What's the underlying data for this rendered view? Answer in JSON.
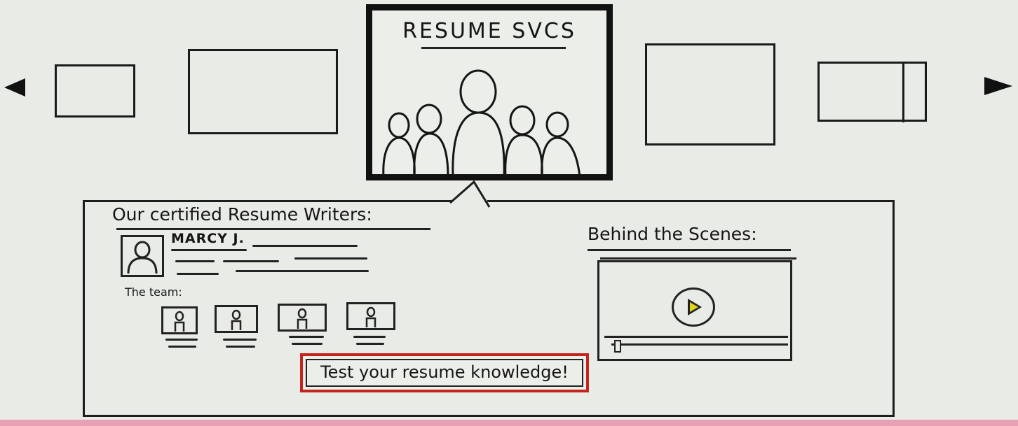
{
  "carousel": {
    "featured_title": "RESUME SVCS",
    "prev_icon": "triangle-left-icon",
    "next_icon": "triangle-right-icon"
  },
  "writers": {
    "title": "Our certified Resume Writers:",
    "profile_name": "MARCY J.",
    "team_label": "The team:"
  },
  "behind_the_scenes": {
    "title": "Behind the Scenes:"
  },
  "quiz_button_label": "Test your resume knowledge!",
  "colors": {
    "button_border": "#c4241c",
    "play_fill": "#e2d41a",
    "bottom_strip": "#e8a0b4"
  }
}
